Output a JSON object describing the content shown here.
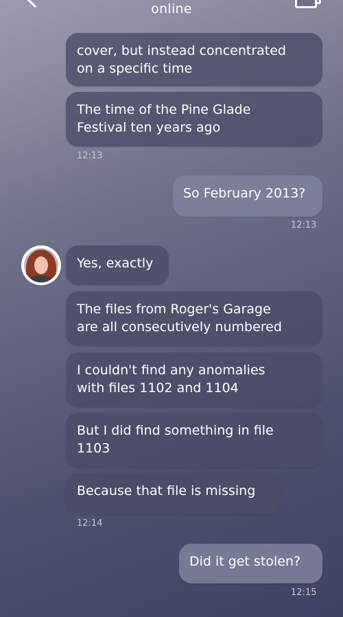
{
  "header": {
    "status": "online"
  },
  "messages": [
    {
      "id": "m1",
      "text": "cover, but instead concentrated\non a specific time"
    },
    {
      "id": "m2",
      "text": "The time of the Pine Glade\nFestival ten years ago"
    },
    {
      "id": "m3",
      "text": "So February 2013?"
    },
    {
      "id": "m4",
      "text": "Yes, exactly"
    },
    {
      "id": "m5",
      "text": "The files from Roger's Garage\nare all consecutively numbered"
    },
    {
      "id": "m6",
      "text": "I couldn't find any anomalies\nwith files 1102 and 1104"
    },
    {
      "id": "m7",
      "text": "But I did find something in file\n1103"
    },
    {
      "id": "m8",
      "text": "Because that file is missing"
    },
    {
      "id": "m9",
      "text": "Did it get stolen?"
    }
  ],
  "timestamps": [
    "12:13",
    "12:13",
    "12:14",
    "12:15"
  ],
  "contact": {
    "avatar_icon": "profile-photo"
  }
}
